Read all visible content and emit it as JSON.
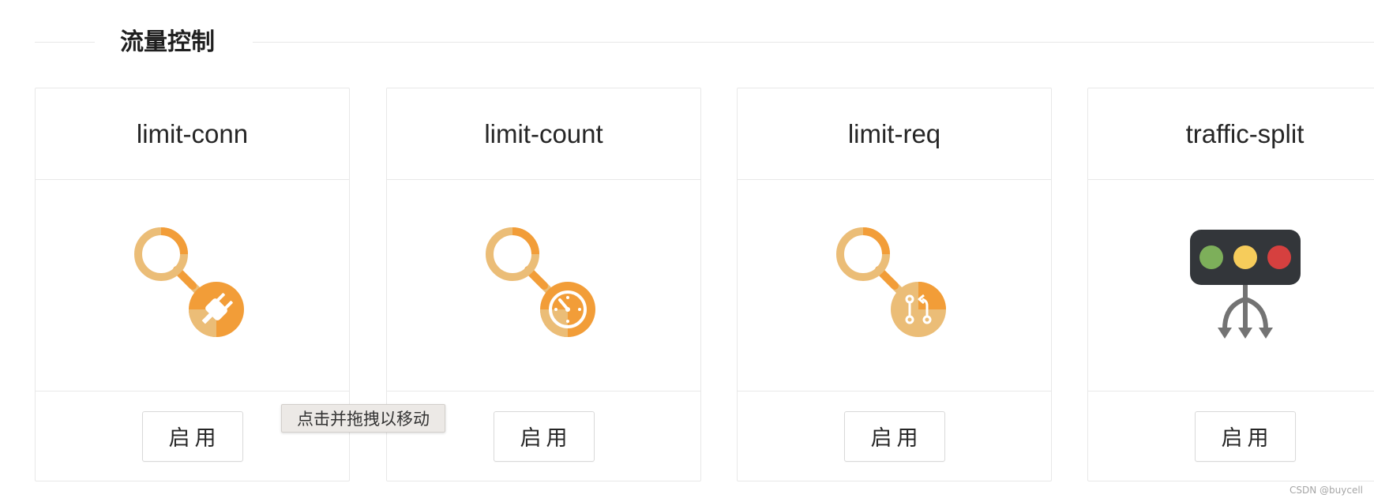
{
  "section": {
    "title": "流量控制"
  },
  "cards": [
    {
      "name": "limit-conn",
      "icon": "plug-link-icon",
      "button_label": "启用"
    },
    {
      "name": "limit-count",
      "icon": "timer-link-icon",
      "button_label": "启用"
    },
    {
      "name": "limit-req",
      "icon": "branch-link-icon",
      "button_label": "启用"
    },
    {
      "name": "traffic-split",
      "icon": "traffic-light-split-icon",
      "button_label": "启用"
    }
  ],
  "tooltip": {
    "text": "点击并拖拽以移动"
  },
  "watermark": "CSDN @buycell",
  "colors": {
    "orange": "#F29D38",
    "light_orange": "#EBBD77",
    "border": "#E8E8E8",
    "traffic_body": "#33363A",
    "green": "#7DAF5A",
    "yellow": "#F6CC5B",
    "red": "#D6403F",
    "arrow_gray": "#737373"
  }
}
